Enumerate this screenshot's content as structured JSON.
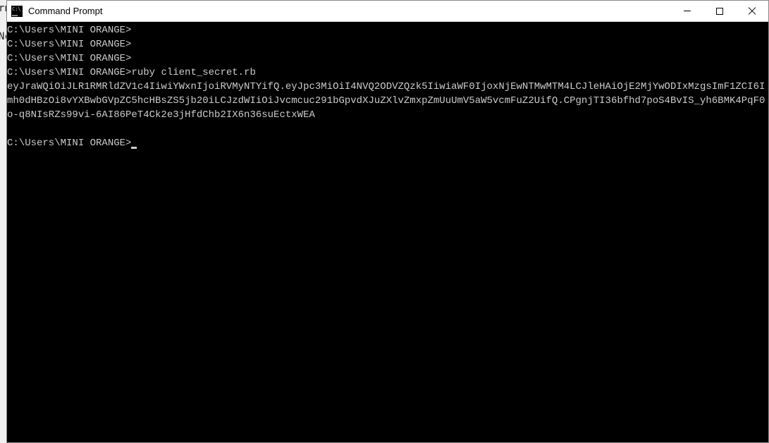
{
  "background": {
    "line1": "rn",
    "line2": "",
    "line3": "Nc",
    "line4": ""
  },
  "titlebar": {
    "title": "Command Prompt"
  },
  "terminal": {
    "prompt_path": "C:\\Users\\MINI ORANGE>",
    "command": "ruby client_secret.rb",
    "output": "eyJraWQiOiJLR1RMRldZV1c4IiwiYWxnIjoiRVMyNTYifQ.eyJpc3MiOiI4NVQ2ODVZQzk5IiwiaWF0IjoxNjEwNTMwMTM4LCJleHAiOjE2MjYwODIxMzgsImF1ZCI6Imh0dHBzOi8vYXBwbGVpZC5hcHBsZS5jb20iLCJzdWIiOiJvcmcuc291bGpvdXJuZXlvZmxpZmUuUmV5aW5vcmFuZ2UifQ.CPgnjTI36bfhd7poS4BvIS_yh6BMK4PqF0o-q8NIsRZs99vi-6AI86PeT4Ck2e3jHfdChb2IX6n36suEctxWEA"
  }
}
